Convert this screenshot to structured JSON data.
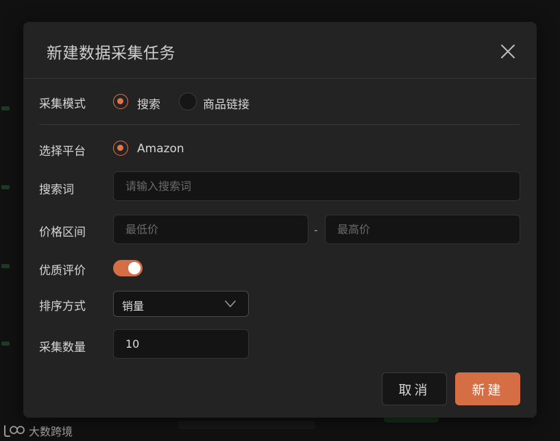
{
  "modal": {
    "title": "新建数据采集任务"
  },
  "form": {
    "mode": {
      "label": "采集模式",
      "options": [
        {
          "label": "搜索",
          "checked": true
        },
        {
          "label": "商品链接",
          "checked": false
        }
      ]
    },
    "platform": {
      "label": "选择平台",
      "options": [
        {
          "label": "Amazon",
          "checked": true
        }
      ]
    },
    "keyword": {
      "label": "搜索词",
      "value": "",
      "placeholder": "请输入搜索词"
    },
    "price": {
      "label": "价格区间",
      "min_placeholder": "最低价",
      "max_placeholder": "最高价",
      "separator": "-"
    },
    "quality": {
      "label": "优质评价",
      "enabled": true
    },
    "sort": {
      "label": "排序方式",
      "selected": "销量"
    },
    "count": {
      "label": "采集数量",
      "value": "10"
    }
  },
  "buttons": {
    "cancel": "取消",
    "create": "新建"
  },
  "watermark": {
    "text": "大数跨境"
  },
  "colors": {
    "accent": "#d66e45",
    "modal_bg": "#232323",
    "input_bg": "#141414"
  }
}
